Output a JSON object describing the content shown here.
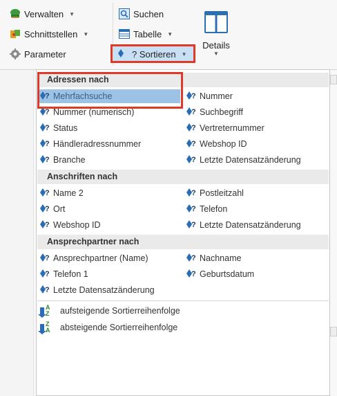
{
  "ribbon": {
    "verwalten": "Verwalten",
    "schnittstellen": "Schnittstellen",
    "parameter": "Parameter",
    "suchen": "Suchen",
    "tabelle": "Tabelle",
    "sortieren": "? Sortieren",
    "details": "Details"
  },
  "menu": {
    "groups": [
      {
        "header": "Adressen nach",
        "left": [
          "Mehrfachsuche",
          "Nummer (numerisch)",
          "Status",
          "Händleradressnummer",
          "Branche"
        ],
        "right": [
          "Nummer",
          "Suchbegriff",
          "Vertreternummer",
          "Webshop ID",
          "Letzte Datensatzänderung"
        ]
      },
      {
        "header": "Anschriften nach",
        "left": [
          "Name 2",
          "Ort",
          "Webshop ID"
        ],
        "right": [
          "Postleitzahl",
          "Telefon",
          "Letzte Datensatzänderung"
        ]
      },
      {
        "header": "Ansprechpartner nach",
        "left": [
          "Ansprechpartner (Name)",
          "Telefon 1",
          "Letzte Datensatzänderung"
        ],
        "right": [
          "Nachname",
          "Geburtsdatum"
        ]
      }
    ],
    "order": [
      "aufsteigende Sortierreihenfolge",
      "absteigende Sortierreihenfolge"
    ],
    "hovered": "Mehrfachsuche"
  },
  "icons": [
    "tree-icon",
    "puzzle-icon",
    "gear-icon",
    "search-icon",
    "table-icon",
    "sort-icon",
    "details-panel-icon",
    "sort-asc-icon",
    "sort-desc-icon"
  ],
  "colors": {
    "highlight_border": "#e03a26",
    "hover_bg": "#9cc3e5",
    "group_header_bg": "#eaeaea",
    "accent": "#2a6db5"
  }
}
